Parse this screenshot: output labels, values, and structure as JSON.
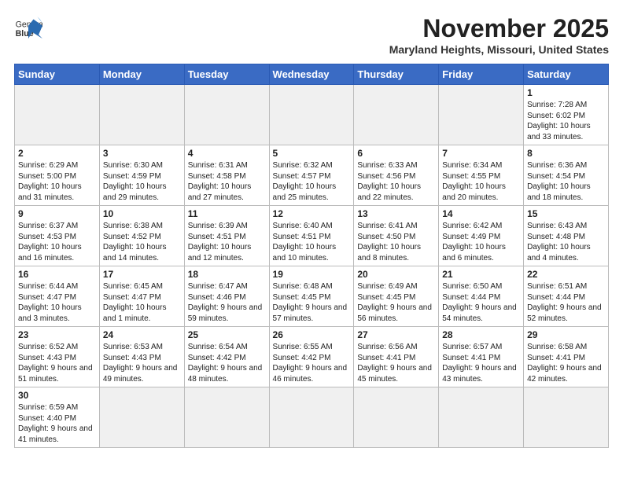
{
  "header": {
    "logo_general": "General",
    "logo_blue": "Blue",
    "month_title": "November 2025",
    "location": "Maryland Heights, Missouri, United States"
  },
  "days_of_week": [
    "Sunday",
    "Monday",
    "Tuesday",
    "Wednesday",
    "Thursday",
    "Friday",
    "Saturday"
  ],
  "weeks": [
    [
      {
        "day": "",
        "info": ""
      },
      {
        "day": "",
        "info": ""
      },
      {
        "day": "",
        "info": ""
      },
      {
        "day": "",
        "info": ""
      },
      {
        "day": "",
        "info": ""
      },
      {
        "day": "",
        "info": ""
      },
      {
        "day": "1",
        "info": "Sunrise: 7:28 AM\nSunset: 6:02 PM\nDaylight: 10 hours and 33 minutes."
      }
    ],
    [
      {
        "day": "2",
        "info": "Sunrise: 6:29 AM\nSunset: 5:00 PM\nDaylight: 10 hours and 31 minutes."
      },
      {
        "day": "3",
        "info": "Sunrise: 6:30 AM\nSunset: 4:59 PM\nDaylight: 10 hours and 29 minutes."
      },
      {
        "day": "4",
        "info": "Sunrise: 6:31 AM\nSunset: 4:58 PM\nDaylight: 10 hours and 27 minutes."
      },
      {
        "day": "5",
        "info": "Sunrise: 6:32 AM\nSunset: 4:57 PM\nDaylight: 10 hours and 25 minutes."
      },
      {
        "day": "6",
        "info": "Sunrise: 6:33 AM\nSunset: 4:56 PM\nDaylight: 10 hours and 22 minutes."
      },
      {
        "day": "7",
        "info": "Sunrise: 6:34 AM\nSunset: 4:55 PM\nDaylight: 10 hours and 20 minutes."
      },
      {
        "day": "8",
        "info": "Sunrise: 6:36 AM\nSunset: 4:54 PM\nDaylight: 10 hours and 18 minutes."
      }
    ],
    [
      {
        "day": "9",
        "info": "Sunrise: 6:37 AM\nSunset: 4:53 PM\nDaylight: 10 hours and 16 minutes."
      },
      {
        "day": "10",
        "info": "Sunrise: 6:38 AM\nSunset: 4:52 PM\nDaylight: 10 hours and 14 minutes."
      },
      {
        "day": "11",
        "info": "Sunrise: 6:39 AM\nSunset: 4:51 PM\nDaylight: 10 hours and 12 minutes."
      },
      {
        "day": "12",
        "info": "Sunrise: 6:40 AM\nSunset: 4:51 PM\nDaylight: 10 hours and 10 minutes."
      },
      {
        "day": "13",
        "info": "Sunrise: 6:41 AM\nSunset: 4:50 PM\nDaylight: 10 hours and 8 minutes."
      },
      {
        "day": "14",
        "info": "Sunrise: 6:42 AM\nSunset: 4:49 PM\nDaylight: 10 hours and 6 minutes."
      },
      {
        "day": "15",
        "info": "Sunrise: 6:43 AM\nSunset: 4:48 PM\nDaylight: 10 hours and 4 minutes."
      }
    ],
    [
      {
        "day": "16",
        "info": "Sunrise: 6:44 AM\nSunset: 4:47 PM\nDaylight: 10 hours and 3 minutes."
      },
      {
        "day": "17",
        "info": "Sunrise: 6:45 AM\nSunset: 4:47 PM\nDaylight: 10 hours and 1 minute."
      },
      {
        "day": "18",
        "info": "Sunrise: 6:47 AM\nSunset: 4:46 PM\nDaylight: 9 hours and 59 minutes."
      },
      {
        "day": "19",
        "info": "Sunrise: 6:48 AM\nSunset: 4:45 PM\nDaylight: 9 hours and 57 minutes."
      },
      {
        "day": "20",
        "info": "Sunrise: 6:49 AM\nSunset: 4:45 PM\nDaylight: 9 hours and 56 minutes."
      },
      {
        "day": "21",
        "info": "Sunrise: 6:50 AM\nSunset: 4:44 PM\nDaylight: 9 hours and 54 minutes."
      },
      {
        "day": "22",
        "info": "Sunrise: 6:51 AM\nSunset: 4:44 PM\nDaylight: 9 hours and 52 minutes."
      }
    ],
    [
      {
        "day": "23",
        "info": "Sunrise: 6:52 AM\nSunset: 4:43 PM\nDaylight: 9 hours and 51 minutes."
      },
      {
        "day": "24",
        "info": "Sunrise: 6:53 AM\nSunset: 4:43 PM\nDaylight: 9 hours and 49 minutes."
      },
      {
        "day": "25",
        "info": "Sunrise: 6:54 AM\nSunset: 4:42 PM\nDaylight: 9 hours and 48 minutes."
      },
      {
        "day": "26",
        "info": "Sunrise: 6:55 AM\nSunset: 4:42 PM\nDaylight: 9 hours and 46 minutes."
      },
      {
        "day": "27",
        "info": "Sunrise: 6:56 AM\nSunset: 4:41 PM\nDaylight: 9 hours and 45 minutes."
      },
      {
        "day": "28",
        "info": "Sunrise: 6:57 AM\nSunset: 4:41 PM\nDaylight: 9 hours and 43 minutes."
      },
      {
        "day": "29",
        "info": "Sunrise: 6:58 AM\nSunset: 4:41 PM\nDaylight: 9 hours and 42 minutes."
      }
    ],
    [
      {
        "day": "30",
        "info": "Sunrise: 6:59 AM\nSunset: 4:40 PM\nDaylight: 9 hours and 41 minutes."
      },
      {
        "day": "",
        "info": ""
      },
      {
        "day": "",
        "info": ""
      },
      {
        "day": "",
        "info": ""
      },
      {
        "day": "",
        "info": ""
      },
      {
        "day": "",
        "info": ""
      },
      {
        "day": "",
        "info": ""
      }
    ]
  ]
}
